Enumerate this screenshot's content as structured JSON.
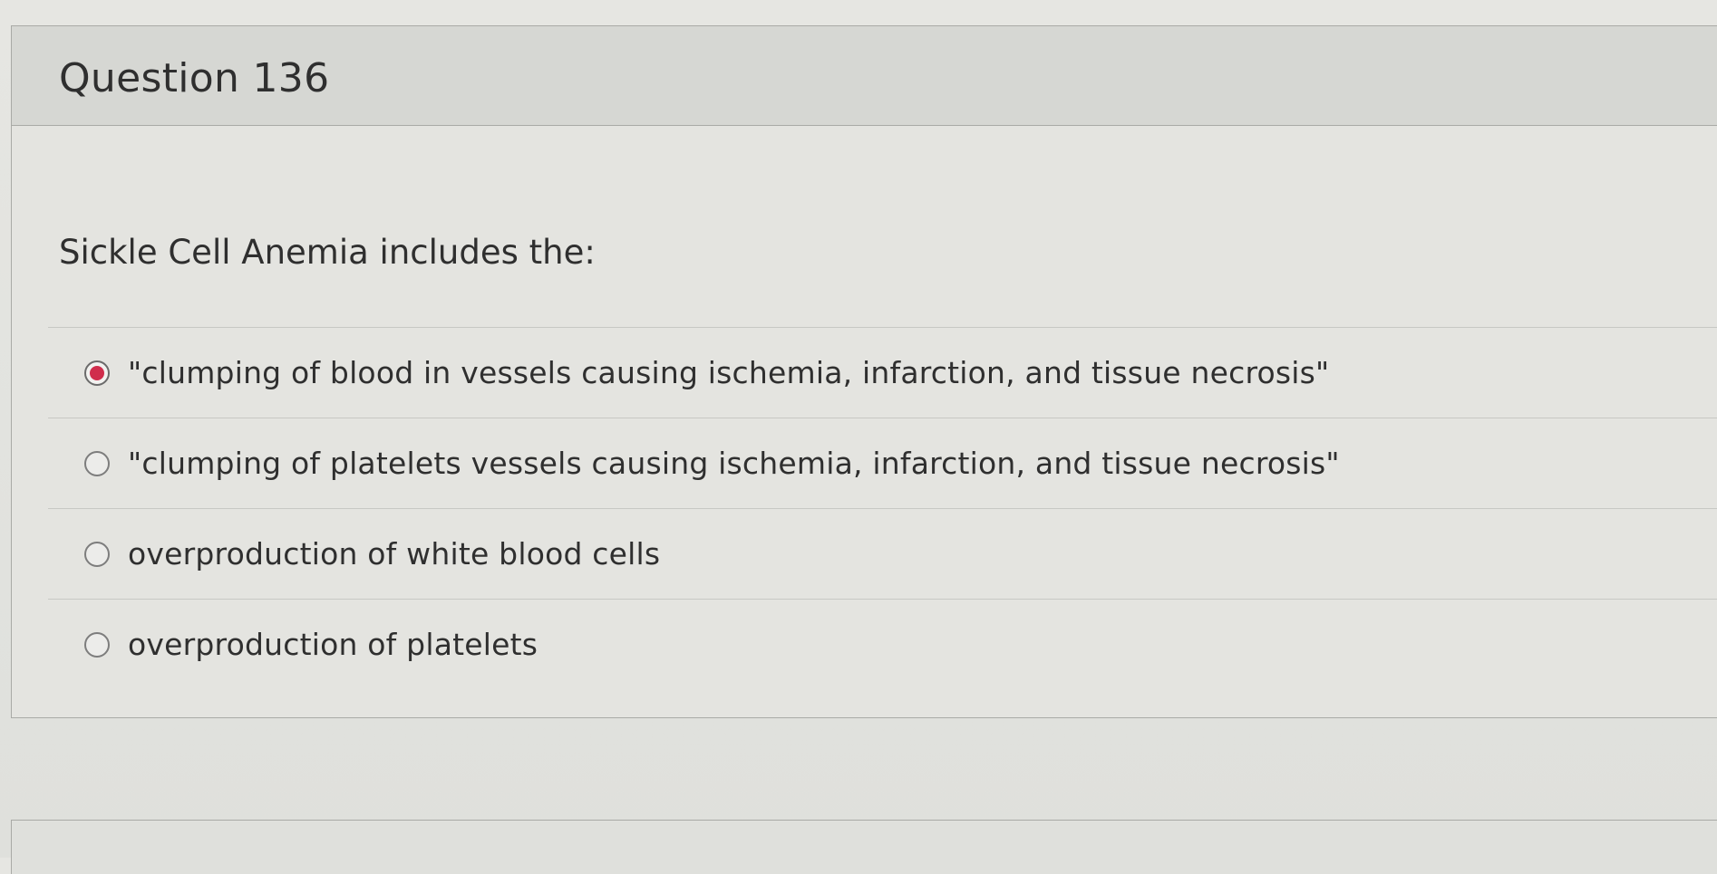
{
  "question": {
    "title": "Question 136",
    "prompt": "Sickle Cell Anemia includes the:",
    "answers": [
      {
        "label": "\"clumping of blood in vessels causing ischemia, infarction, and tissue necrosis\"",
        "selected": true
      },
      {
        "label": "\"clumping of platelets vessels causing ischemia, infarction, and tissue necrosis\"",
        "selected": false
      },
      {
        "label": "overproduction of white blood cells",
        "selected": false
      },
      {
        "label": "overproduction of platelets",
        "selected": false
      }
    ]
  },
  "colors": {
    "selected_radio": "#d02d4c",
    "header_background": "#d6d7d3",
    "card_background": "#e4e4e0"
  }
}
